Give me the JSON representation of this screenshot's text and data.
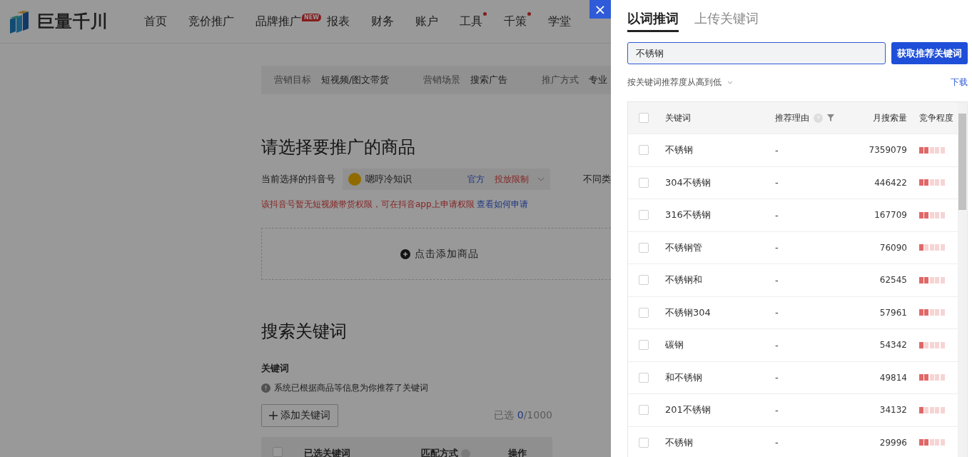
{
  "header": {
    "logo_text": "巨量千川",
    "nav": [
      {
        "label": "首页",
        "dot": false
      },
      {
        "label": "竞价推广",
        "dot": false
      },
      {
        "label": "品牌推广",
        "badge": "NEW",
        "dot": false
      },
      {
        "label": "报表",
        "dot": false
      },
      {
        "label": "财务",
        "dot": false
      },
      {
        "label": "账户",
        "dot": false
      },
      {
        "label": "工具",
        "dot": true
      },
      {
        "label": "千策",
        "dot": true
      },
      {
        "label": "学堂",
        "dot": false
      }
    ]
  },
  "filter_bar": [
    {
      "label": "营销目标",
      "value": "短视频/图文带货"
    },
    {
      "label": "营销场景",
      "value": "搜索广告"
    },
    {
      "label": "推广方式",
      "value": "专业"
    }
  ],
  "product_section": {
    "title": "请选择要推广的商品",
    "account_label": "当前选择的抖音号",
    "account_name": "嗯哼冷知识",
    "tag_official": "官方",
    "tag_limit": "投放限制",
    "side_text": "不同类",
    "warning": "该抖音号暂无短视频带货权限，可在抖音app上申请权限",
    "warning_link": "查看如何申请",
    "add_product": "点击添加商品"
  },
  "keyword_section": {
    "title": "搜索关键词",
    "label": "关键词",
    "info": "系统已根据商品等信息为你推荐了关键词",
    "add_button": "添加关键词",
    "selected_label": "已选",
    "selected_count": "0",
    "selected_total": "/1000",
    "select_all_checked": false,
    "columns": [
      "已选关键词",
      "匹配方式",
      "操作"
    ]
  },
  "drawer": {
    "close": "×",
    "tabs": [
      {
        "label": "以词推词",
        "selected": true
      },
      {
        "label": "上传关键词",
        "selected": false
      }
    ],
    "search_value": "不锈钢",
    "search_button": "获取推荐关键词",
    "sort": "按关键词推荐度从高到低",
    "download": "下载",
    "select_all_checked": false,
    "columns": [
      "关键词",
      "推荐理由",
      "月搜索量",
      "竞争程度"
    ],
    "rows": [
      {
        "keyword": "不锈钢",
        "reason": "-",
        "volume": "7359079",
        "level": 0.4,
        "checked": false
      },
      {
        "keyword": "304不锈钢",
        "reason": "-",
        "volume": "446422",
        "level": 0.4,
        "checked": false
      },
      {
        "keyword": "316不锈钢",
        "reason": "-",
        "volume": "167709",
        "level": 0.4,
        "checked": false
      },
      {
        "keyword": "不锈钢管",
        "reason": "-",
        "volume": "76090",
        "level": 0.2,
        "checked": false
      },
      {
        "keyword": "不锈钢和",
        "reason": "-",
        "volume": "62545",
        "level": 0.4,
        "checked": false
      },
      {
        "keyword": "不锈钢304",
        "reason": "-",
        "volume": "57961",
        "level": 0.4,
        "checked": false
      },
      {
        "keyword": "碳钢",
        "reason": "-",
        "volume": "54342",
        "level": 0.2,
        "checked": false
      },
      {
        "keyword": "和不锈钢",
        "reason": "-",
        "volume": "49814",
        "level": 0.4,
        "checked": false
      },
      {
        "keyword": "201不锈钢",
        "reason": "-",
        "volume": "34132",
        "level": 0.2,
        "checked": false
      },
      {
        "keyword": "不锈钢",
        "reason": "-",
        "volume": "29996",
        "level": 0.4,
        "checked": false
      }
    ]
  }
}
